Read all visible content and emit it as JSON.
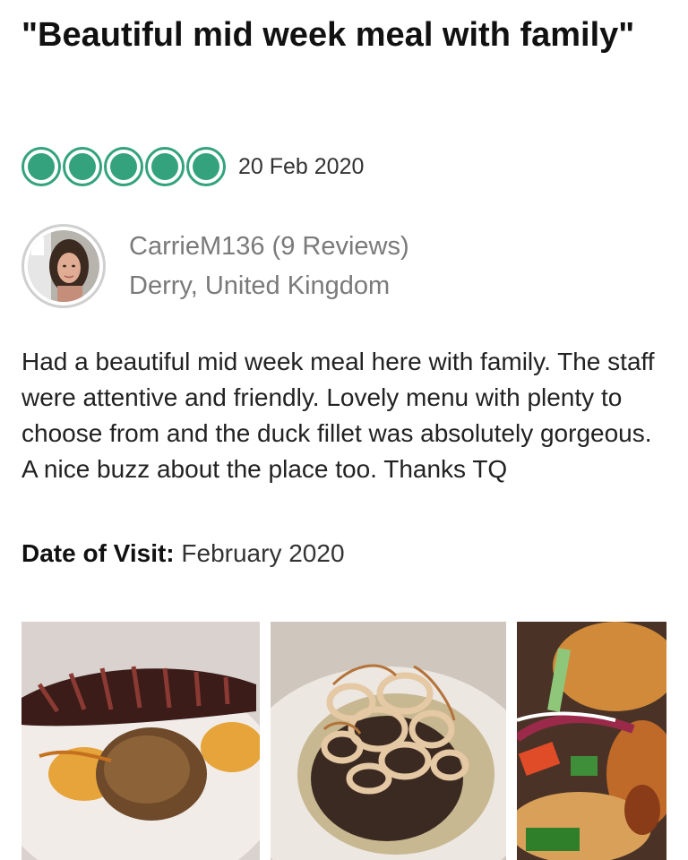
{
  "review": {
    "title": "\"Beautiful mid week meal with family\"",
    "rating": 5,
    "rating_max": 5,
    "date": "20 Feb 2020",
    "body": "Had a beautiful mid week meal here with family. The staff were attentive and friendly. Lovely menu with plenty to choose from and the duck fillet was absolutely gorgeous. A nice buzz about the place too. Thanks TQ",
    "visit_label": "Date of Visit:",
    "visit_value": "February 2020"
  },
  "reviewer": {
    "name_line": "CarrieM136 (9 Reviews)",
    "location": "Derry, United Kingdom"
  },
  "colors": {
    "rating_green": "#34a37d",
    "meta_gray": "#7a7a7a"
  },
  "photos": [
    {
      "name": "duck-fillet-photo"
    },
    {
      "name": "steak-onion-photo"
    },
    {
      "name": "salad-photo"
    }
  ]
}
